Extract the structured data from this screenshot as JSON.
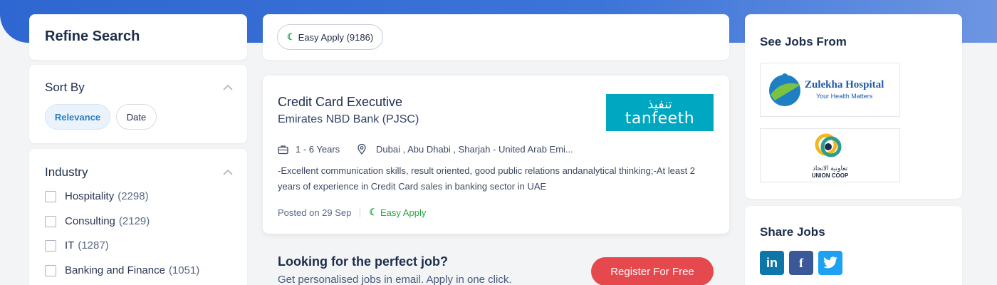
{
  "sidebar": {
    "title": "Refine Search",
    "sort": {
      "title": "Sort By",
      "options": [
        "Relevance",
        "Date"
      ],
      "selected": "Relevance"
    },
    "industry": {
      "title": "Industry",
      "items": [
        {
          "label": "Hospitality",
          "count": "(2298)"
        },
        {
          "label": "Consulting",
          "count": "(2129)"
        },
        {
          "label": "IT",
          "count": "(1287)"
        },
        {
          "label": "Banking and Finance",
          "count": "(1051)"
        }
      ]
    }
  },
  "filters": {
    "easy_apply_label": "Easy Apply (9186)"
  },
  "job": {
    "title": "Credit Card Executive",
    "company": "Emirates NBD Bank (PJSC)",
    "logo_arabic": "تنفيذ",
    "logo_text": "tanfeeth",
    "experience": "1 - 6 Years",
    "location": "Dubai , Abu Dhabi , Sharjah - United Arab Emi...",
    "description": "-Excellent communication skills, result oriented, good public relations andanalytical thinking;-At least 2 years of experience in Credit Card sales in banking sector in UAE",
    "posted": "Posted on 29 Sep",
    "easy_apply": "Easy Apply"
  },
  "promo": {
    "title": "Looking for the perfect job?",
    "subtitle": "Get personalised jobs in email. Apply in one click.",
    "button": "Register For Free"
  },
  "see_jobs": {
    "title": "See Jobs From",
    "companies": [
      {
        "name": "Zulekha Hospital",
        "tagline": "Your Health Matters"
      },
      {
        "name_ar": "تعاونية الاتحاد",
        "name": "UNION COOP"
      }
    ]
  },
  "share": {
    "title": "Share Jobs",
    "networks": [
      {
        "label": "in",
        "icon": "linkedin-icon",
        "color": "#0e76a8"
      },
      {
        "label": "f",
        "icon": "facebook-icon",
        "color": "#3b5998"
      },
      {
        "label": "t",
        "icon": "twitter-icon",
        "color": "#1da1f2"
      }
    ]
  },
  "colors": {
    "accent_blue": "#2f67d2",
    "easy_apply_green": "#28a745",
    "register_red": "#e5484d",
    "tanfeeth_teal": "#00a7c1"
  }
}
